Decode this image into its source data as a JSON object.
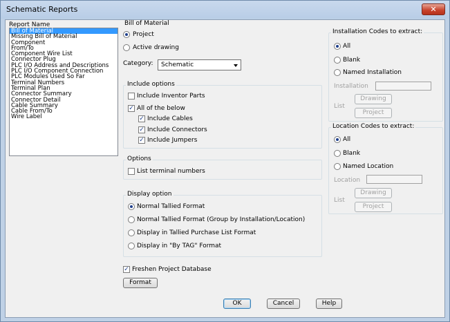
{
  "window": {
    "title": "Schematic Reports",
    "close": "✕"
  },
  "reports": {
    "label": "Report Name",
    "items": [
      "Bill of Material",
      "Missing Bill of Material",
      "Component",
      "From/To",
      "Component Wire List",
      "Connector Plug",
      "PLC I/O Address and Descriptions",
      "PLC I/O Component Connection",
      "PLC Modules Used So Far",
      "Terminal Numbers",
      "Terminal Plan",
      "Connector Summary",
      "Connector Detail",
      "Cable Summary",
      "Cable From/To",
      "Wire Label"
    ],
    "selected": "Bill of Material"
  },
  "bom": {
    "title": "Bill of Material",
    "project": "Project",
    "active_drawing": "Active drawing",
    "category_label": "Category:",
    "category_value": "Schematic"
  },
  "include": {
    "title": "Include options",
    "inventor": "Include Inventor Parts",
    "all_below": "All of the below",
    "cables": "Include Cables",
    "connectors": "Include Connectors",
    "jumpers": "Include Jumpers"
  },
  "options": {
    "title": "Options",
    "terminal": "List terminal numbers"
  },
  "display": {
    "title": "Display option",
    "normal": "Normal Tallied Format",
    "grouped": "Normal Tallied Format (Group by Installation/Location)",
    "purchase": "Display in Tallied Purchase List Format",
    "bytag": "Display in \"By TAG\" Format"
  },
  "freshen": "Freshen Project Database",
  "format_button": "Format",
  "installation": {
    "title": "Installation Codes to extract:",
    "all": "All",
    "blank": "Blank",
    "named": "Named Installation",
    "field_label": "Installation",
    "drawing_button": "Drawing",
    "list_label": "List",
    "project_button": "Project"
  },
  "location": {
    "title": "Location Codes to extract:",
    "all": "All",
    "blank": "Blank",
    "named": "Named Location",
    "field_label": "Location",
    "drawing_button": "Drawing",
    "list_label": "List",
    "project_button": "Project"
  },
  "footer": {
    "ok": "OK",
    "cancel": "Cancel",
    "help": "Help"
  }
}
